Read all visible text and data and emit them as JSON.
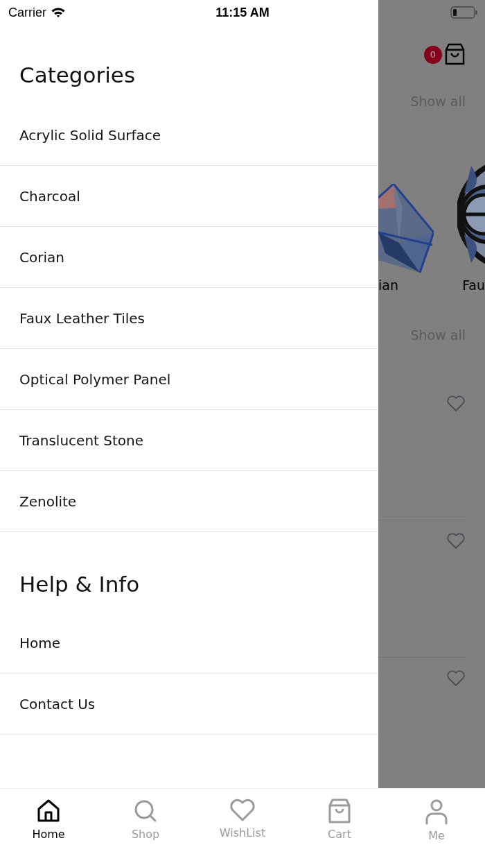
{
  "status_bar": {
    "carrier": "Carrier",
    "time": "11:15 AM"
  },
  "drawer": {
    "sections": [
      {
        "title": "Categories",
        "items": [
          "Acrylic Solid Surface",
          "Charcoal",
          "Corian",
          "Faux Leather Tiles",
          "Optical Polymer Panel",
          "Translucent Stone",
          "Zenolite"
        ]
      },
      {
        "title": "Help & Info",
        "items": [
          "Home",
          "Contact Us"
        ]
      }
    ]
  },
  "background_page": {
    "cart_badge": "0",
    "show_all_links": [
      "Show all",
      "Show all"
    ],
    "category_labels": [
      "ian",
      "Fau"
    ],
    "products": [
      {
        "favorited": false
      },
      {
        "favorited": false
      },
      {
        "favorited": false
      }
    ]
  },
  "tab_bar": [
    {
      "label": "Home",
      "kind": "home",
      "selected": true
    },
    {
      "label": "Shop",
      "kind": "search",
      "selected": false
    },
    {
      "label": "WishList",
      "kind": "wishlist",
      "selected": false
    },
    {
      "label": "Cart",
      "kind": "cart",
      "selected": false
    },
    {
      "label": "Me",
      "kind": "profile",
      "selected": false
    }
  ]
}
